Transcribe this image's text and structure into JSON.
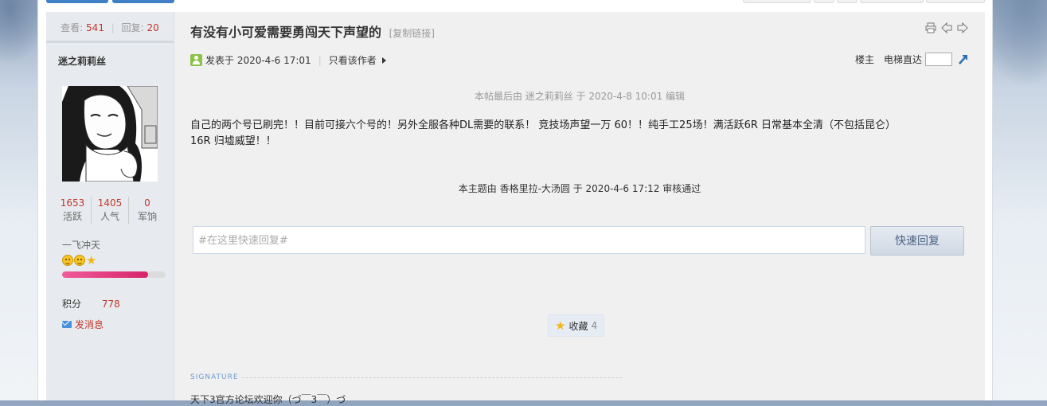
{
  "sidebar": {
    "views_label": "查看:",
    "views": "541",
    "replies_label": "回复:",
    "replies": "20",
    "author_name": "迷之莉莉丝",
    "stats": [
      {
        "value": "1653",
        "label": "活跃"
      },
      {
        "value": "1405",
        "label": "人气"
      },
      {
        "value": "0",
        "label": "军饷"
      }
    ],
    "group_title": "一飞冲天",
    "level_progress": 0.83,
    "score_label": "积分",
    "score_value": "778",
    "pm_label": "发消息"
  },
  "post": {
    "title": "有没有小可爱需要勇闯天下声望的",
    "copy_link": "[复制链接]",
    "posted_at": "发表于 2020-4-6 17:01",
    "only_author": "只看该作者",
    "floor_label": "楼主",
    "jump_label": "电梯直达",
    "edit_note": "本帖最后由 迷之莉莉丝 于 2020-4-8 10:01 编辑",
    "content_line1": "自己的两个号已刷完！！目前可接六个号的！另外全服各种DL需要的联系！  竞技场声望一万 60！！纯手工25场！满活跃6R 日常基本全清（不包括昆仑）",
    "content_line2": "16R  归墟威望！！",
    "moderation_note": "本主题由 香格里拉-大汤圆 于 2020-4-6 17:12 审核通过"
  },
  "reply": {
    "placeholder": "#在这里快速回复#",
    "button_label": "快速回复"
  },
  "favorite": {
    "label": "收藏",
    "count": "4"
  },
  "signature": {
    "label": "SIGNATURE",
    "text": "天下3官方论坛欢迎你（づ￣3￣）づ"
  }
}
